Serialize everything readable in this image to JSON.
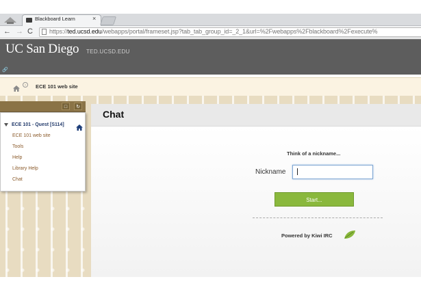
{
  "browser": {
    "tab_title": "Blackboard Learn",
    "tab_close": "×",
    "url_prefix": "https://",
    "url_domain": "ted.ucsd.edu",
    "url_rest": "/webapps/portal/frameset.jsp?tab_tab_group_id=_2_1&url=%2Fwebapps%2Fblackboard%2Fexecute%"
  },
  "header": {
    "logo": "UC San Diego",
    "site": "TED.UCSD.EDU"
  },
  "breadcrumb": {
    "current": "ECE 101 web site"
  },
  "course_menu": {
    "course": "ECE 101 - Quest [S114]",
    "items": [
      "ECE 101 web site",
      "Tools",
      "Help",
      "Library Help",
      "Chat"
    ]
  },
  "content": {
    "title": "Chat",
    "prompt": "Think of a nickname...",
    "nickname_label": "Nickname",
    "nickname_value": "",
    "start_label": "Start...",
    "powered_by": "Powered by Kiwi IRC"
  },
  "colors": {
    "header_bg": "#5d5d5d",
    "start_button": "#8ab83d",
    "menu_link": "#8a5a2a",
    "course_link": "#223a6b"
  },
  "icons": [
    "home-icon",
    "refresh-icon",
    "folder-icon",
    "leaf-icon",
    "link-icon"
  ]
}
